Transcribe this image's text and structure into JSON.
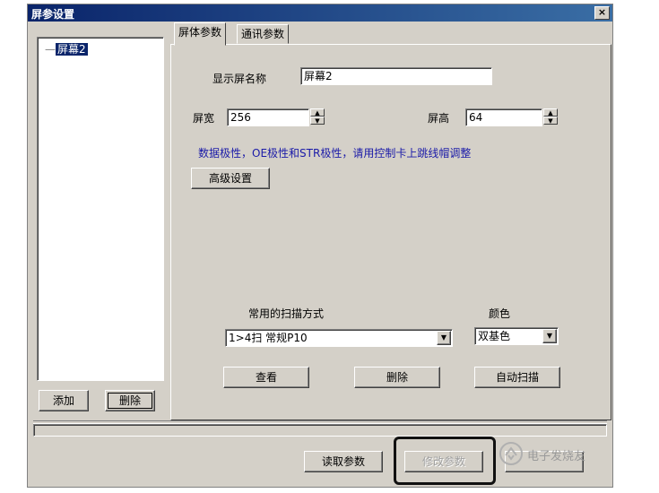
{
  "window": {
    "title": "屏参设置",
    "close_glyph": "×"
  },
  "tree": {
    "items": [
      {
        "label": "屏幕2"
      }
    ]
  },
  "left_buttons": {
    "add": "添加",
    "delete": "删除"
  },
  "tabs": [
    {
      "label": "屏体参数"
    },
    {
      "label": "通讯参数"
    }
  ],
  "screen_params": {
    "name_label": "显示屏名称",
    "name_value": "屏幕2",
    "width_label": "屏宽",
    "width_value": "256",
    "height_label": "屏高",
    "height_value": "64",
    "notice": "数据极性，OE极性和STR极性，请用控制卡上跳线帽调整",
    "advanced_button": "高级设置",
    "scan_label": "常用的扫描方式",
    "scan_value": "1>4扫 常规P10",
    "color_label": "颜色",
    "color_value": "双基色",
    "view_button": "查看",
    "delete_button": "删除",
    "auto_scan_button": "自动扫描"
  },
  "bottom_buttons": {
    "read": "读取参数",
    "modify": "修改参数"
  },
  "watermark": {
    "text": "电子发烧友"
  },
  "icons": {
    "close": "close-icon",
    "spin_up": "spin-up-icon",
    "spin_down": "spin-down-icon",
    "dropdown": "chevron-down-icon",
    "watermark_logo": "watermark-logo-icon"
  },
  "colors": {
    "title_bar": "#0a246a",
    "selected": "#0a246a",
    "notice_text": "#1a1aa8",
    "face": "#d4d0c8"
  }
}
